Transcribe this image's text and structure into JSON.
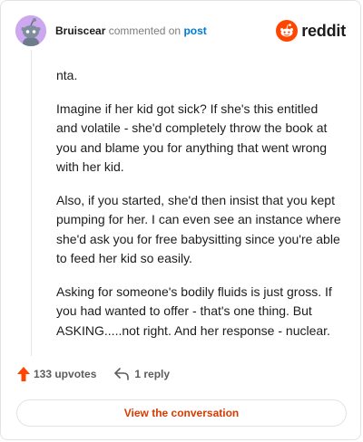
{
  "header": {
    "author": "Bruiscear",
    "action": "commented on",
    "post_link": "post",
    "brand_name": "reddit",
    "avatar_color": "#cda8f0"
  },
  "comment": {
    "paragraphs": [
      "nta.",
      "Imagine if her kid got sick? If she's this entitled and volatile - she'd completely throw the book at you and blame you for anything that went wrong with her kid.",
      "Also, if you started, she'd then insist that you kept pumping for her. I can even see an instance where she'd ask you for free babysitting since you're able to feed her kid so easily.",
      "Asking for someone's bodily fluids is just gross. If you had wanted to offer - that's one thing. But ASKING.....not right. And her response - nuclear."
    ]
  },
  "actions": {
    "upvotes": "133 upvotes",
    "replies": "1 reply",
    "upvote_icon": "upvote-arrow-icon",
    "reply_icon": "reply-arrow-icon"
  },
  "cta": {
    "label": "View the conversation"
  },
  "colors": {
    "accent": "#d93a00",
    "brand": "#ff4500",
    "link": "#0079d3"
  }
}
